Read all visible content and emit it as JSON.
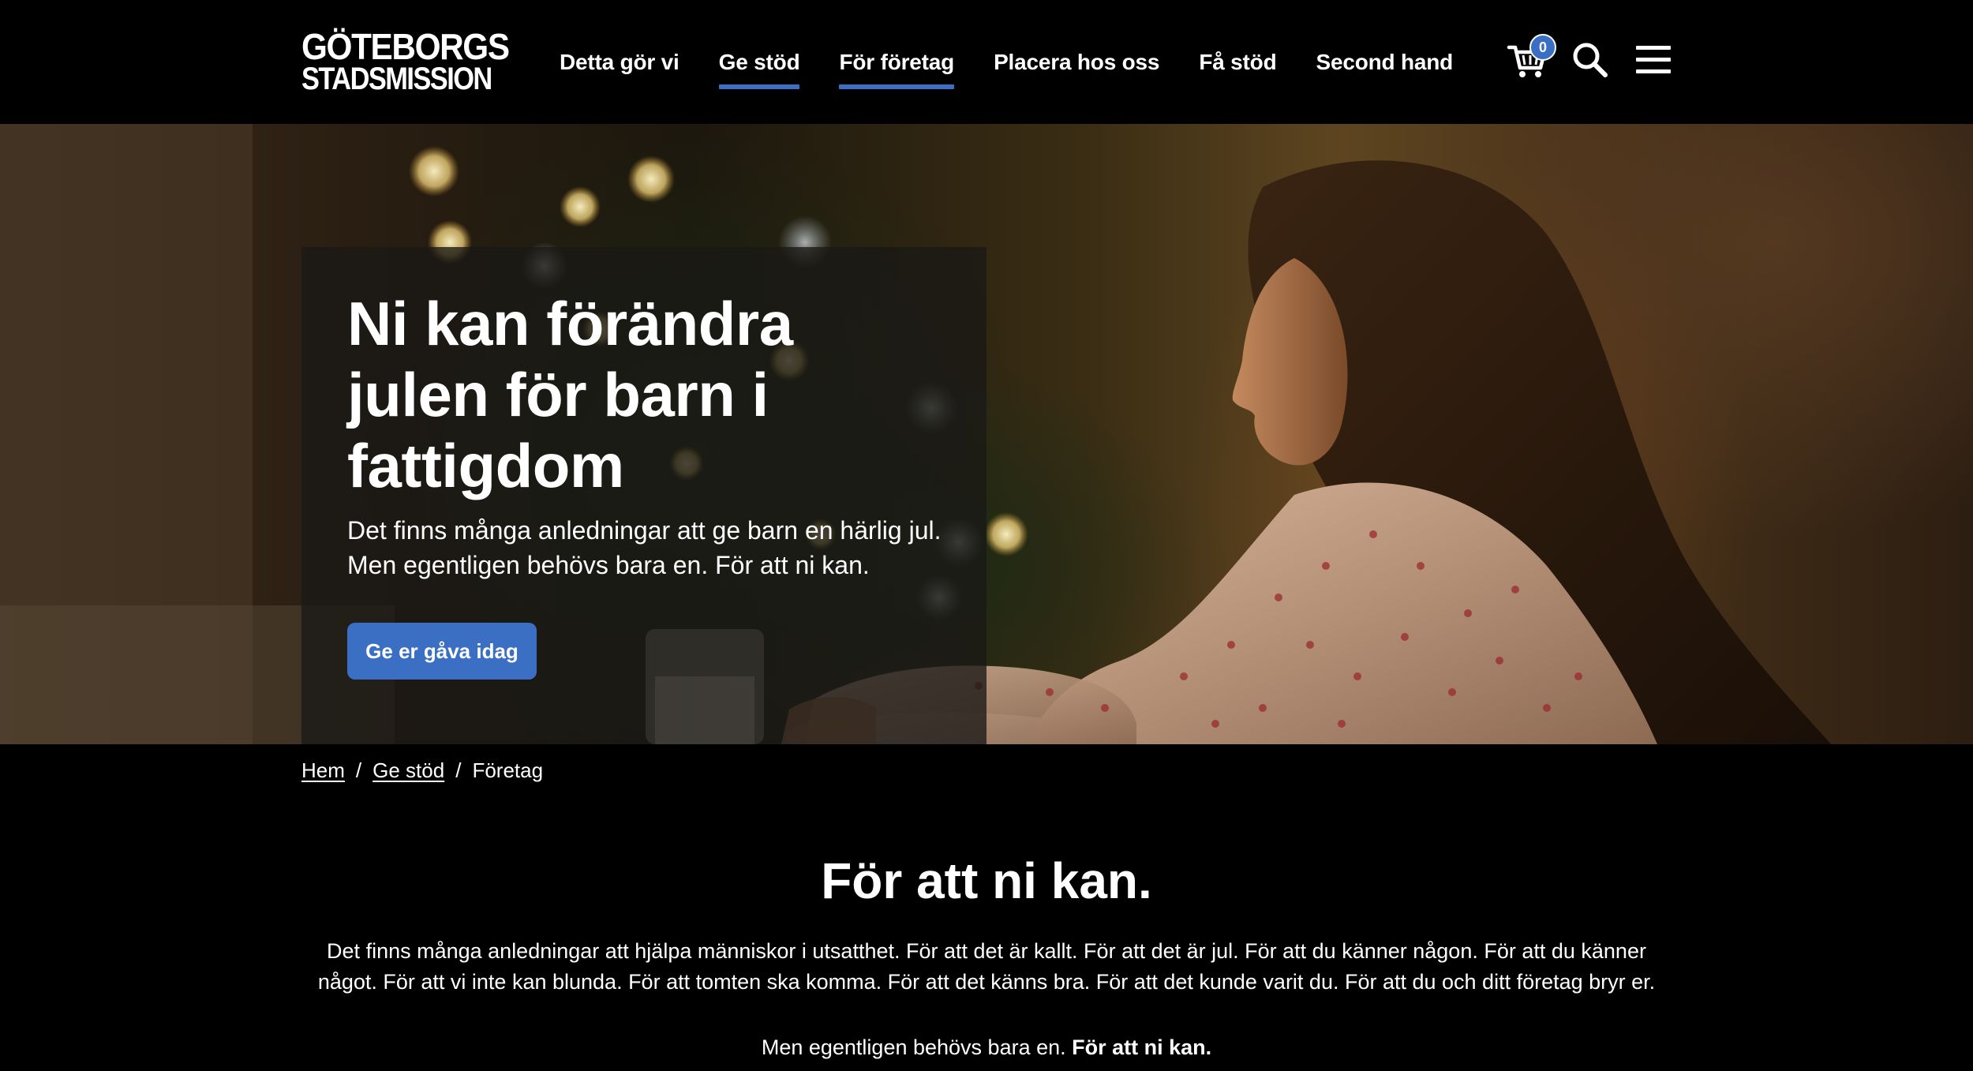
{
  "brand": {
    "line1": "GÖTEBORGS",
    "line2": "STADSMISSION"
  },
  "nav": {
    "items": [
      {
        "label": "Detta gör vi",
        "active": false
      },
      {
        "label": "Ge stöd",
        "active": true
      },
      {
        "label": "För företag",
        "active": true
      },
      {
        "label": "Placera hos oss",
        "active": false
      },
      {
        "label": "Få stöd",
        "active": false
      },
      {
        "label": "Second hand",
        "active": false
      }
    ],
    "cart_count": "0",
    "icons": [
      "cart-icon",
      "search-icon",
      "menu-icon"
    ]
  },
  "hero": {
    "title": "Ni kan förändra julen för barn i fattigdom",
    "subtitle": "Det finns många anledningar att ge barn en härlig jul. Men egentligen behövs bara en. För att ni kan.",
    "cta_label": "Ge er gåva idag"
  },
  "breadcrumb": {
    "items": [
      "Hem",
      "Ge stöd",
      "Företag"
    ],
    "separator": "/"
  },
  "main": {
    "title": "För att ni kan.",
    "body": "Det finns många anledningar att hjälpa människor i utsatthet. För att det är kallt. För att det är jul. För att du känner någon. För att du känner något. För att vi inte kan blunda. För att tomten ska komma. För att det känns bra. För att det kunde varit du. För att du och ditt företag bryr er.",
    "tagline_lead": "Men egentligen behövs bara en.",
    "tagline_bold": "För att ni kan."
  },
  "colors": {
    "accent": "#3b6fc4",
    "background": "#000000",
    "text": "#ffffff"
  }
}
